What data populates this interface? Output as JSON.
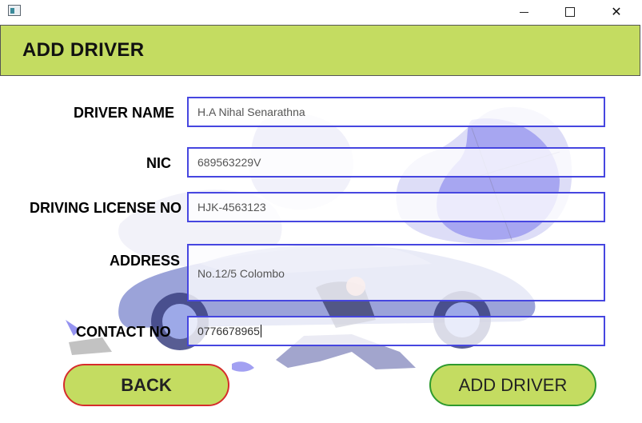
{
  "window": {
    "icons": {
      "app": "app-icon",
      "minimize": "minimize-icon",
      "maximize": "maximize-icon",
      "close": "close-icon"
    },
    "close_glyph": "✕"
  },
  "header": {
    "title": "ADD DRIVER",
    "color": "#c4dc61"
  },
  "form": {
    "driver_name": {
      "label": "DRIVER NAME",
      "value": "H.A Nihal Senarathna"
    },
    "nic": {
      "label": "NIC",
      "value": "689563229V"
    },
    "license": {
      "label": "DRIVING LICENSE NO",
      "value": "HJK-4563123"
    },
    "address": {
      "label": "ADDRESS",
      "value": "No.12/5 Colombo"
    },
    "contact": {
      "label": "CONTACT NO",
      "value": "0776678965"
    }
  },
  "buttons": {
    "back": {
      "label": "BACK"
    },
    "add": {
      "label": "ADD DRIVER"
    }
  },
  "colors": {
    "accent": "#c4dc61",
    "field_border": "#4646e0",
    "back_border": "#d62c2c",
    "add_border": "#2e9a2e"
  }
}
